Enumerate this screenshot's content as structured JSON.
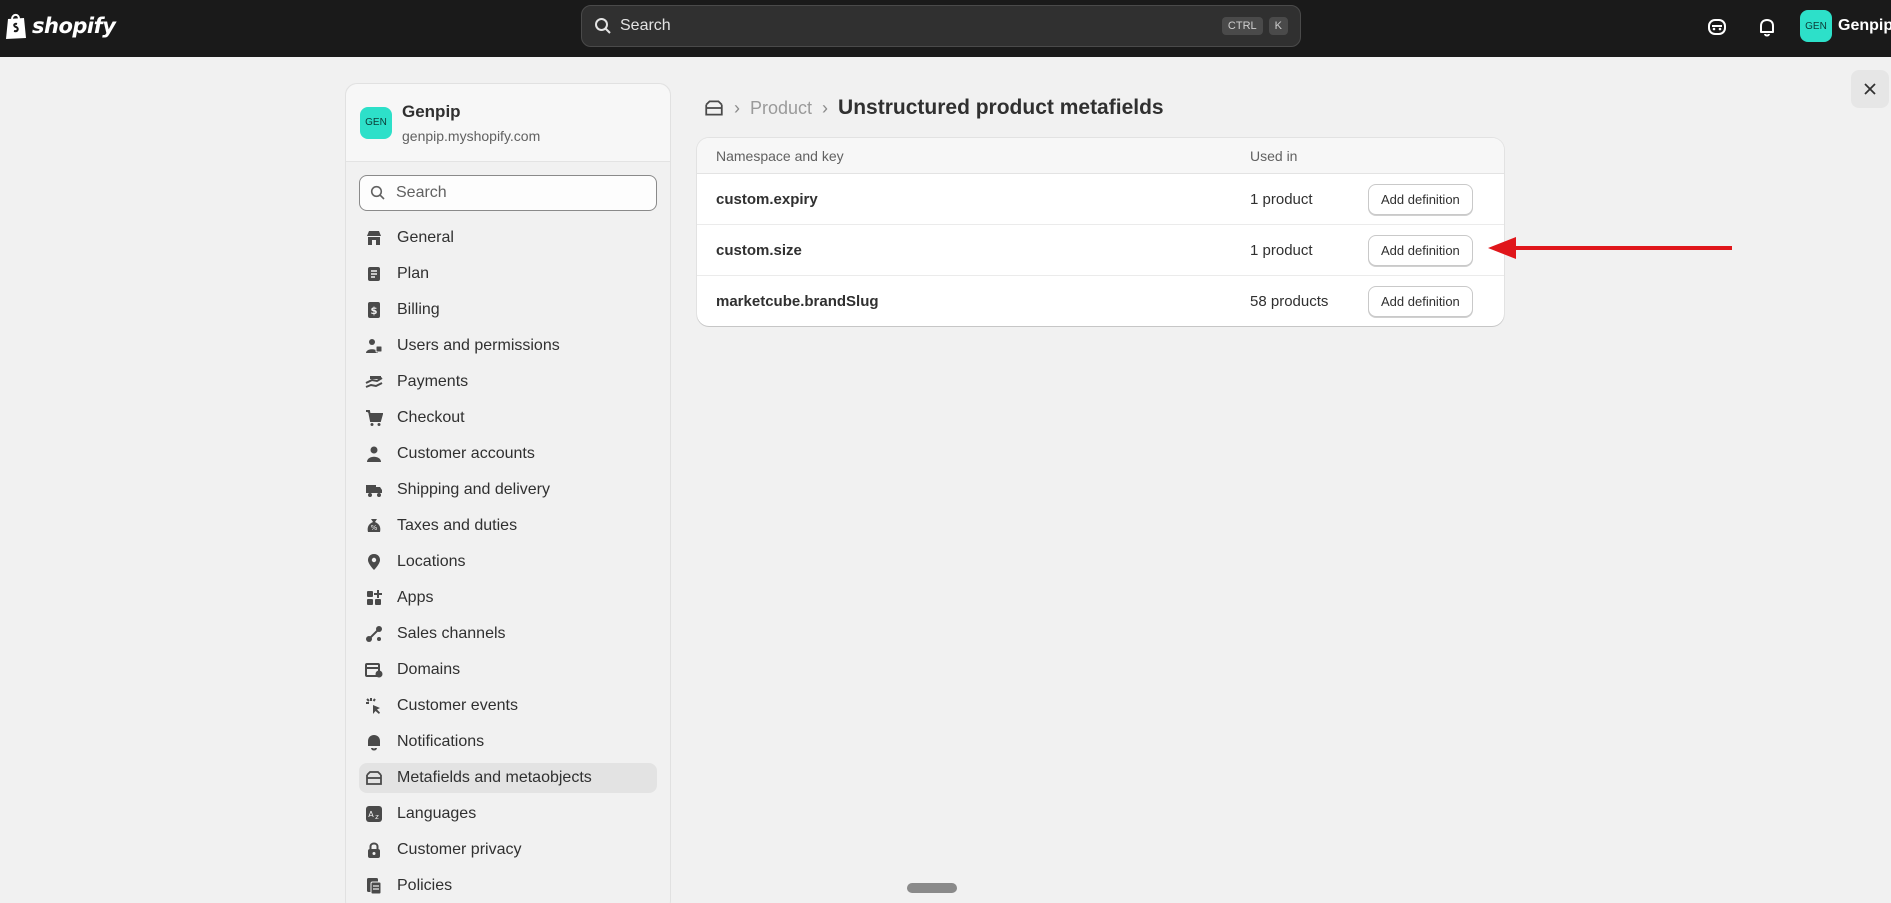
{
  "topbar": {
    "logo_text": "shopify",
    "search_placeholder": "Search",
    "shortcut_ctrl": "CTRL",
    "shortcut_k": "K",
    "user_initials": "GEN",
    "user_name": "Genpip"
  },
  "store": {
    "initials": "GEN",
    "name": "Genpip",
    "url": "genpip.myshopify.com"
  },
  "sidebar": {
    "search_placeholder": "Search",
    "items": [
      {
        "label": "General",
        "icon": "store-icon"
      },
      {
        "label": "Plan",
        "icon": "plan-icon"
      },
      {
        "label": "Billing",
        "icon": "billing-icon"
      },
      {
        "label": "Users and permissions",
        "icon": "users-icon"
      },
      {
        "label": "Payments",
        "icon": "payments-icon"
      },
      {
        "label": "Checkout",
        "icon": "cart-icon"
      },
      {
        "label": "Customer accounts",
        "icon": "person-icon"
      },
      {
        "label": "Shipping and delivery",
        "icon": "truck-icon"
      },
      {
        "label": "Taxes and duties",
        "icon": "tax-icon"
      },
      {
        "label": "Locations",
        "icon": "location-icon"
      },
      {
        "label": "Apps",
        "icon": "apps-icon"
      },
      {
        "label": "Sales channels",
        "icon": "channels-icon"
      },
      {
        "label": "Domains",
        "icon": "domains-icon"
      },
      {
        "label": "Customer events",
        "icon": "events-icon"
      },
      {
        "label": "Notifications",
        "icon": "bell-icon"
      },
      {
        "label": "Metafields and metaobjects",
        "icon": "metafields-icon",
        "active": true
      },
      {
        "label": "Languages",
        "icon": "languages-icon"
      },
      {
        "label": "Customer privacy",
        "icon": "lock-icon"
      },
      {
        "label": "Policies",
        "icon": "policies-icon"
      }
    ]
  },
  "breadcrumb": {
    "parent": "Product",
    "title": "Unstructured product metafields"
  },
  "table": {
    "headers": [
      "Namespace and key",
      "Used in"
    ],
    "rows": [
      {
        "key": "custom.expiry",
        "used_in": "1 product",
        "action": "Add definition"
      },
      {
        "key": "custom.size",
        "used_in": "1 product",
        "action": "Add definition"
      },
      {
        "key": "marketcube.brandSlug",
        "used_in": "58 products",
        "action": "Add definition"
      }
    ]
  },
  "colors": {
    "topbar": "#1a1a1a",
    "avatar": "#2de0c9",
    "annotation_arrow": "#e0161b"
  }
}
